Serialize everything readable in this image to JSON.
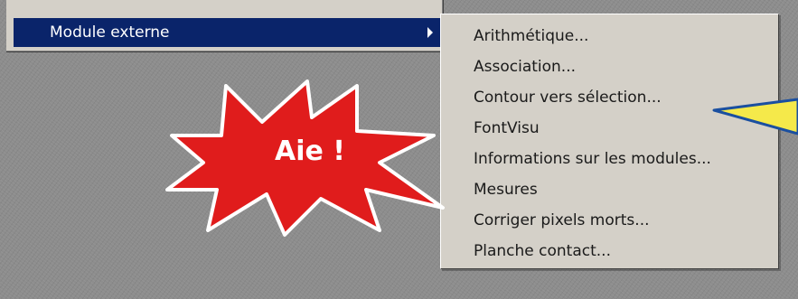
{
  "parent_menu": {
    "highlighted_item": "Module externe"
  },
  "submenu": {
    "items": [
      "Arithmétique...",
      "Association...",
      "Contour vers sélection...",
      "FontVisu",
      "Informations sur les modules...",
      "Mesures",
      "Corriger pixels morts...",
      "Planche contact..."
    ]
  },
  "annotation": {
    "burst_text": "Aie !",
    "burst_color": "#e01c1c",
    "pointer_color": "#f5e94a"
  }
}
